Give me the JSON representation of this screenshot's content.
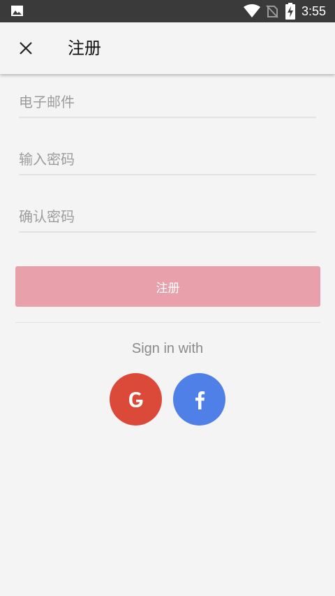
{
  "status_bar": {
    "time": "3:55",
    "icons": [
      "image-icon",
      "wifi-icon",
      "no-sim-icon",
      "battery-charging-icon"
    ]
  },
  "app_bar": {
    "close_icon": "close-icon",
    "title": "注册"
  },
  "form": {
    "email_placeholder": "电子邮件",
    "password_placeholder": "输入密码",
    "confirm_password_placeholder": "确认密码",
    "submit_label": "注册"
  },
  "social": {
    "heading": "Sign in with",
    "google_label": "G",
    "facebook_label": "f"
  },
  "colors": {
    "status_bar": "#3a3a3a",
    "background": "#f4f4f4",
    "submit_button": "#e8a0aa",
    "google": "#db4a39",
    "facebook": "#4f80e8"
  }
}
